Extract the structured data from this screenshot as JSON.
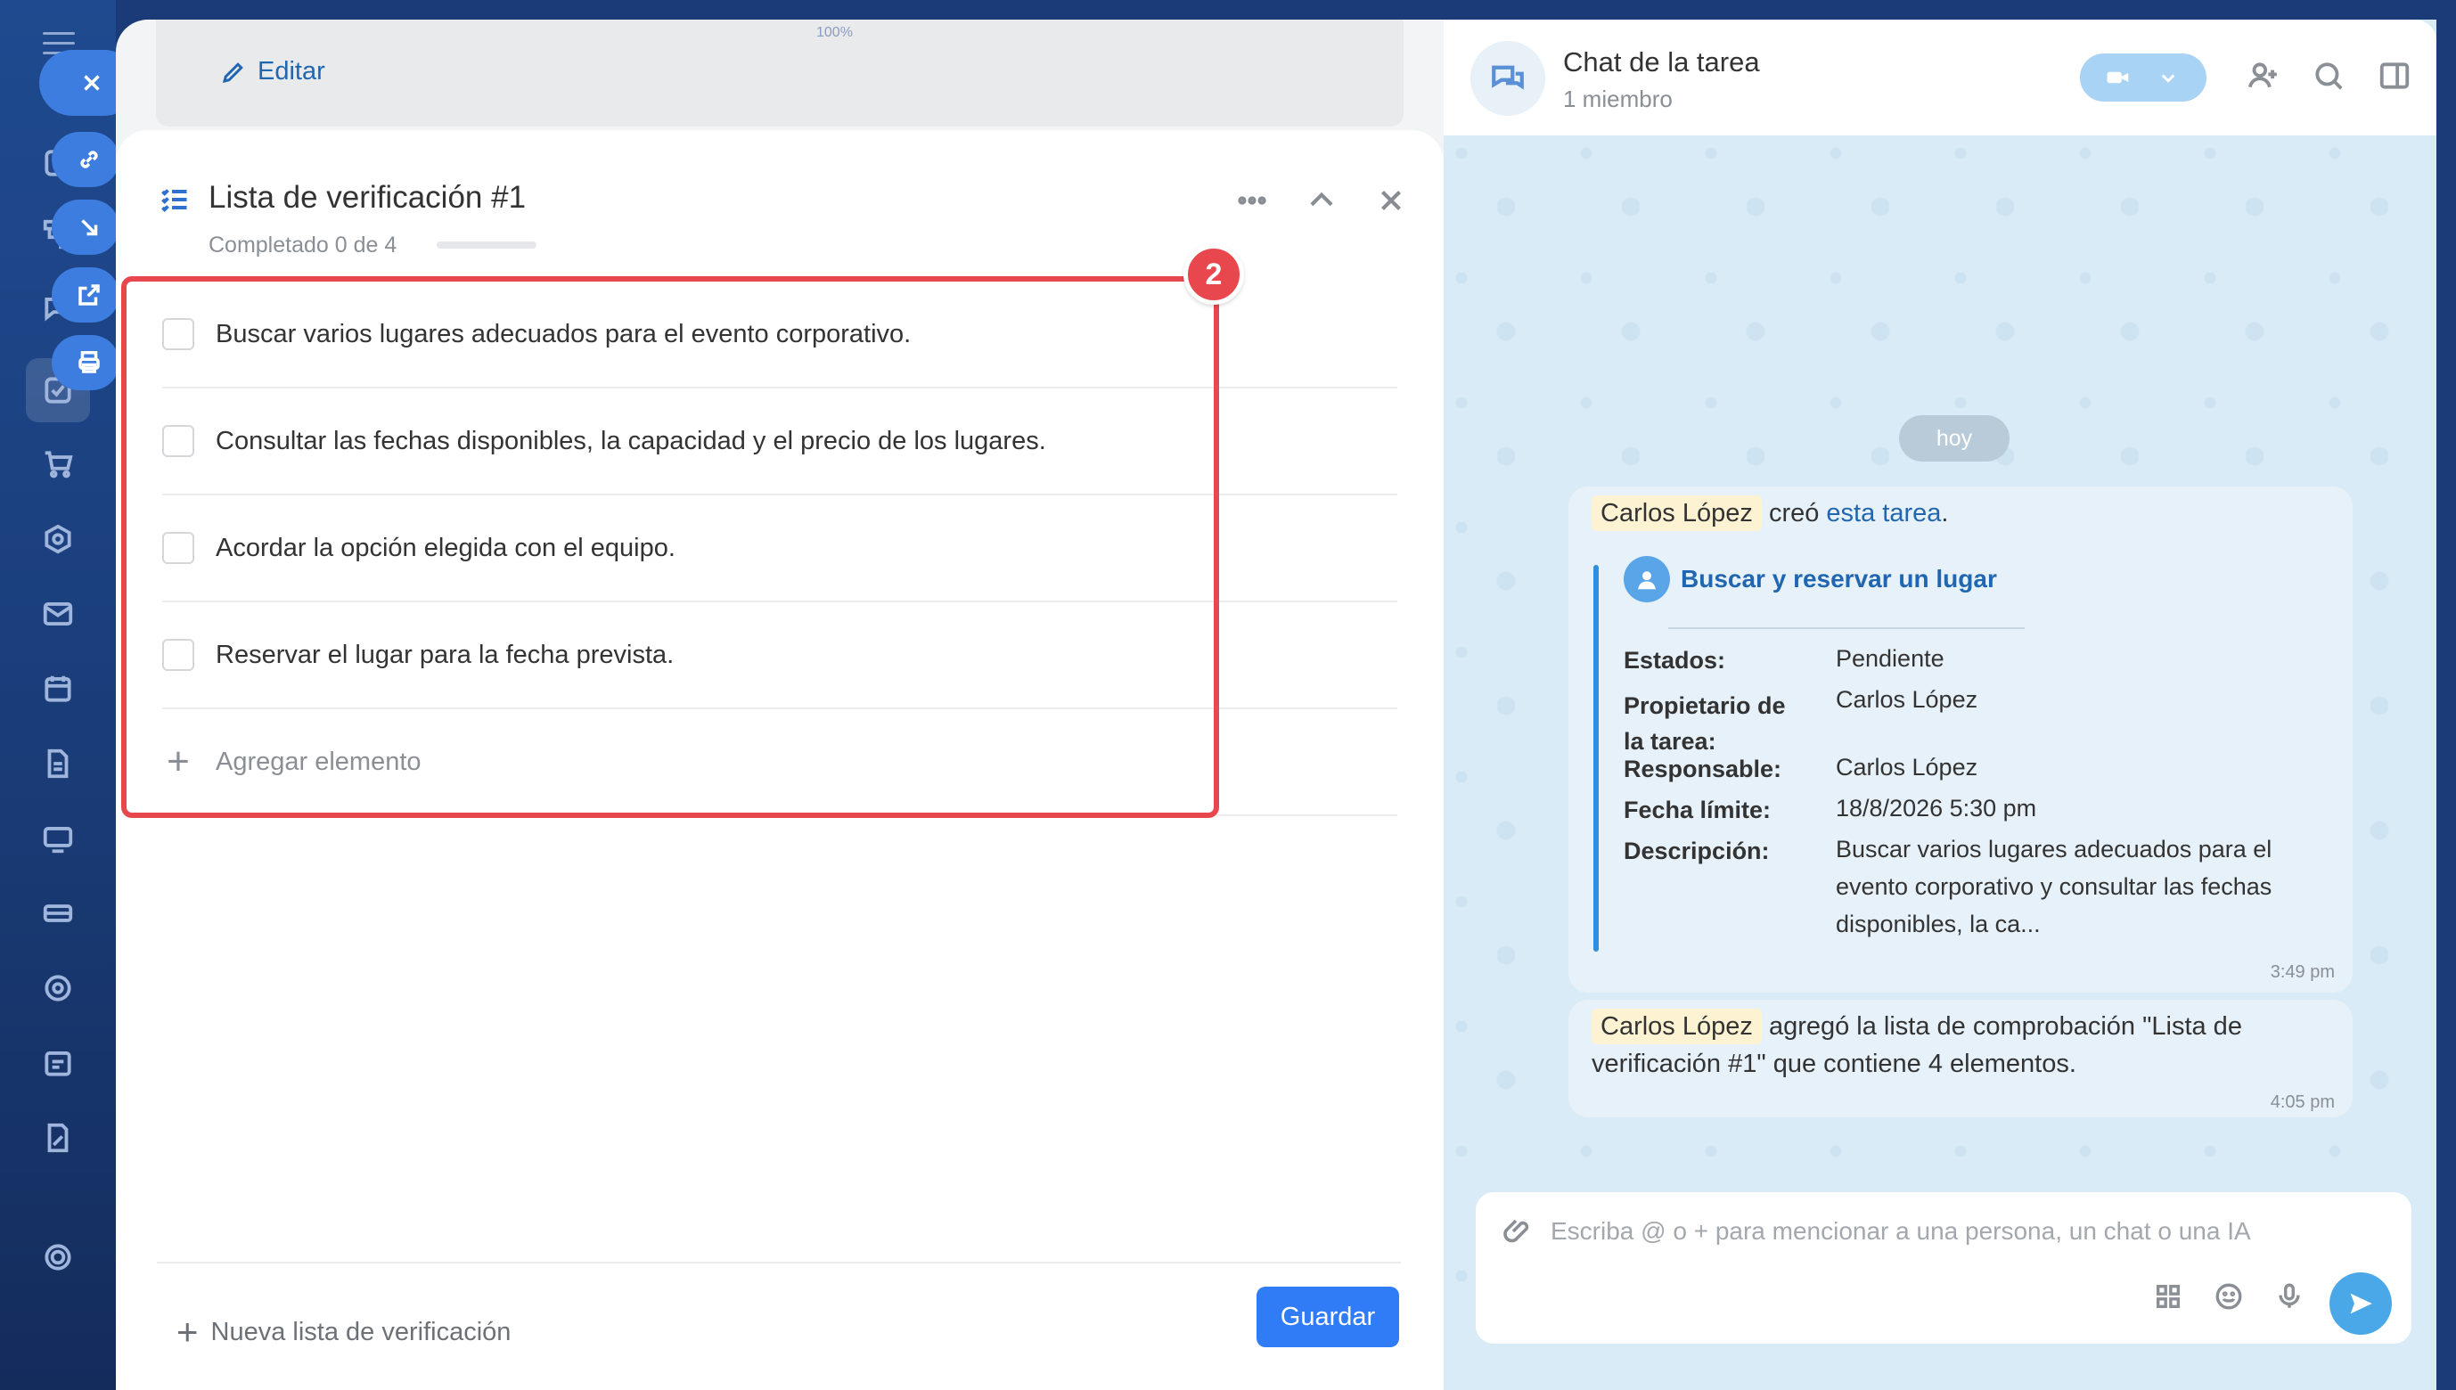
{
  "top_zoom": "100%",
  "toolbar": {
    "edit_label": "Editar"
  },
  "checklist": {
    "title": "Lista de verificación #1",
    "progress_text": "Completado 0 de 4",
    "progress_fraction": 0,
    "items": [
      {
        "label": "Buscar varios lugares adecuados para el evento corporativo.",
        "checked": false
      },
      {
        "label": "Consultar las fechas disponibles, la capacidad y el precio de los lugares.",
        "checked": false
      },
      {
        "label": "Acordar la opción elegida con el equipo.",
        "checked": false
      },
      {
        "label": "Reservar el lugar para la fecha prevista.",
        "checked": false
      }
    ],
    "add_item_label": "Agregar elemento",
    "annotation_badge": "2"
  },
  "footer": {
    "new_list_label": "Nueva lista de verificación",
    "save_label": "Guardar"
  },
  "chat": {
    "title": "Chat de la tarea",
    "subtitle": "1 miembro",
    "day_label": "hoy",
    "message1": {
      "author": "Carlos López",
      "verb": "creó",
      "link": "esta tarea",
      "period": ".",
      "task_title": "Buscar y reservar un lugar",
      "fields": [
        {
          "key": "Estados:",
          "value": "Pendiente"
        },
        {
          "key": "Propietario de la tarea:",
          "value": "Carlos López"
        },
        {
          "key": "Responsable:",
          "value": "Carlos López"
        },
        {
          "key": "Fecha límite:",
          "value": "18/8/2026 5:30 pm"
        },
        {
          "key": "Descripción:",
          "value": "Buscar varios lugares adecuados para el evento corporativo y consultar las fechas disponibles, la ca..."
        }
      ],
      "time": "3:49 pm"
    },
    "message2": {
      "author": "Carlos López",
      "text_line1": "agregó la lista de comprobación \"Lista de",
      "text_line2": "verificación #1\" que contiene 4 elementos.",
      "time": "4:05 pm"
    },
    "composer_placeholder": "Escriba @ o + para mencionar a una persona, un chat o una IA"
  },
  "colors": {
    "accent": "#2f7cf6",
    "highlight": "#e8474d",
    "link": "#2066b0"
  }
}
